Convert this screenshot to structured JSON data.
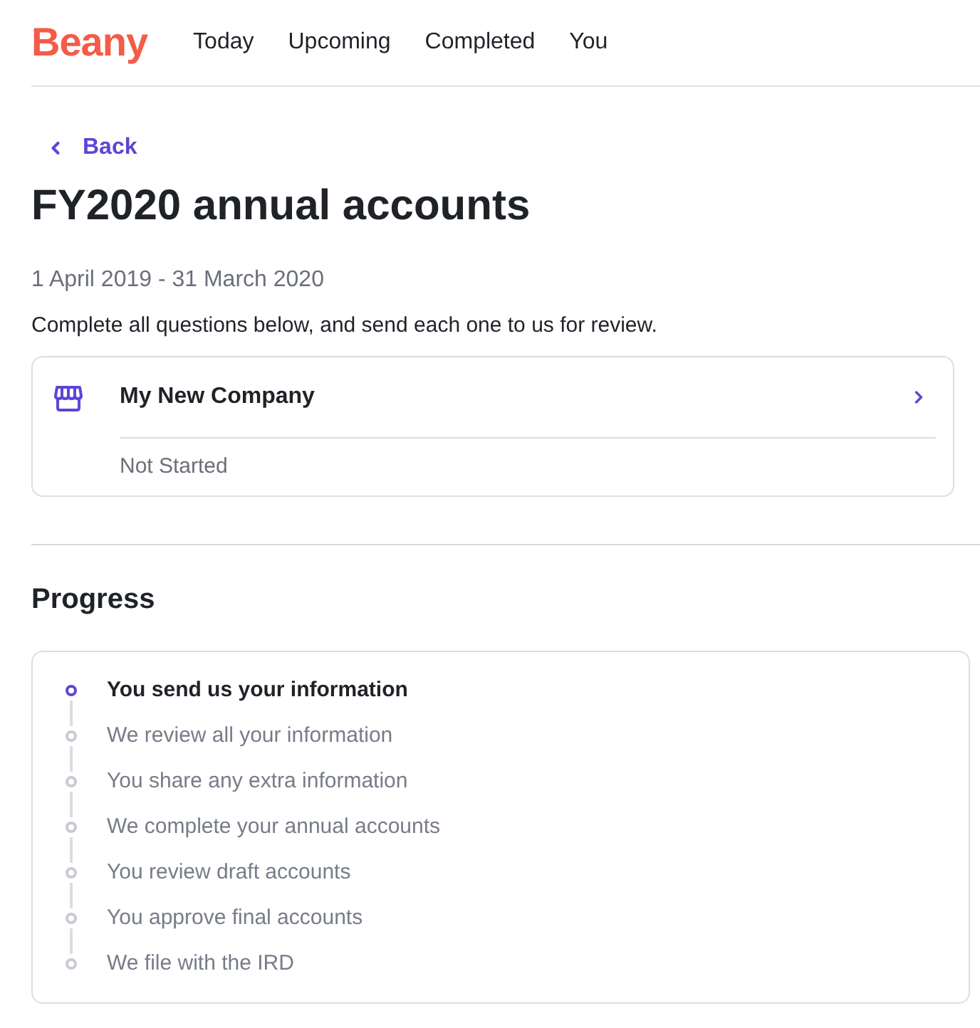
{
  "header": {
    "logo": "Beany",
    "nav": [
      "Today",
      "Upcoming",
      "Completed",
      "You"
    ]
  },
  "page": {
    "back": "Back",
    "title": "FY2020 annual accounts",
    "period": "1 April 2019 - 31 March 2020",
    "instructions": "Complete all questions below, and send each one to us for review."
  },
  "companies": [
    {
      "name": "My New Company",
      "status": "Not Started"
    }
  ],
  "progress": {
    "title": "Progress",
    "steps": [
      {
        "label": "You send us your information",
        "current": true
      },
      {
        "label": "We review all your information",
        "current": false
      },
      {
        "label": "You share any extra information",
        "current": false
      },
      {
        "label": "We complete your annual accounts",
        "current": false
      },
      {
        "label": "You review draft accounts",
        "current": false
      },
      {
        "label": "You approve final accounts",
        "current": false
      },
      {
        "label": "We file with the IRD",
        "current": false
      }
    ]
  }
}
